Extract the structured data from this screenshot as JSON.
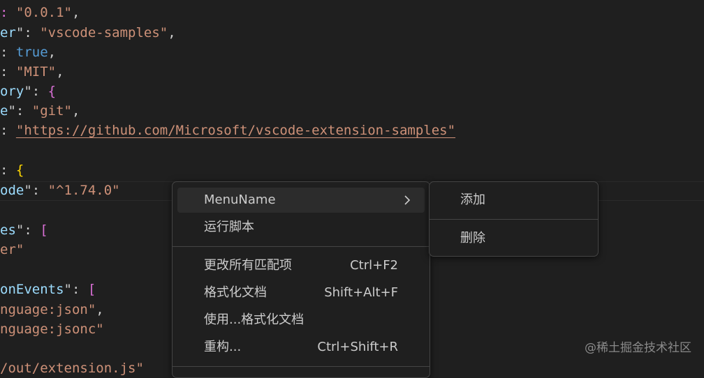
{
  "editor": {
    "lines": [
      {
        "key": "",
        "rest": ": \"0.0.1\","
      },
      {
        "key": "er",
        "rest": "\": \"vscode-samples\","
      },
      {
        "key": "",
        "rest": ": true,"
      },
      {
        "key": "",
        "rest": ": \"MIT\","
      },
      {
        "key": "ory",
        "rest": "\": {"
      },
      {
        "key": "e",
        "rest": "\": \"git\","
      },
      {
        "key": "",
        "rest": ": \"https://github.com/Microsoft/vscode-extension-samples\""
      },
      {
        "key": "",
        "rest": ""
      },
      {
        "key": "",
        "rest": ": {"
      },
      {
        "key": "ode",
        "rest": "\": \"^1.74.0\""
      },
      {
        "key": "",
        "rest": ""
      },
      {
        "key": "es",
        "rest": "\": ["
      },
      {
        "key": "er",
        "rest": "\""
      },
      {
        "key": "",
        "rest": ""
      },
      {
        "key": "onEvents",
        "rest": "\": ["
      },
      {
        "key": "nguage:json",
        "rest": "\","
      },
      {
        "key": "nguage:jsonc",
        "rest": "\""
      },
      {
        "key": "",
        "rest": ""
      },
      {
        "key": "/out/extension.js",
        "rest": "\""
      }
    ]
  },
  "context_menu": {
    "items": [
      {
        "label": "MenuName",
        "shortcut": "",
        "has_submenu": true
      },
      {
        "label": "运行脚本",
        "shortcut": ""
      },
      {
        "label": "更改所有匹配项",
        "shortcut": "Ctrl+F2"
      },
      {
        "label": "格式化文档",
        "shortcut": "Shift+Alt+F"
      },
      {
        "label": "使用...格式化文档",
        "shortcut": ""
      },
      {
        "label": "重构...",
        "shortcut": "Ctrl+Shift+R"
      }
    ]
  },
  "submenu": {
    "items": [
      {
        "label": "添加"
      },
      {
        "label": "删除"
      }
    ]
  },
  "watermark": "@稀土掘金技术社区",
  "colors": {
    "background": "#1f1f1f",
    "menu_border": "#454545",
    "menu_active": "#2c2c2c",
    "string": "#ce9178",
    "key": "#9cdcfe",
    "keyword": "#569cd6",
    "bracket": "#da70d6"
  },
  "icons": {
    "submenu_arrow": "chevron-right-icon"
  }
}
